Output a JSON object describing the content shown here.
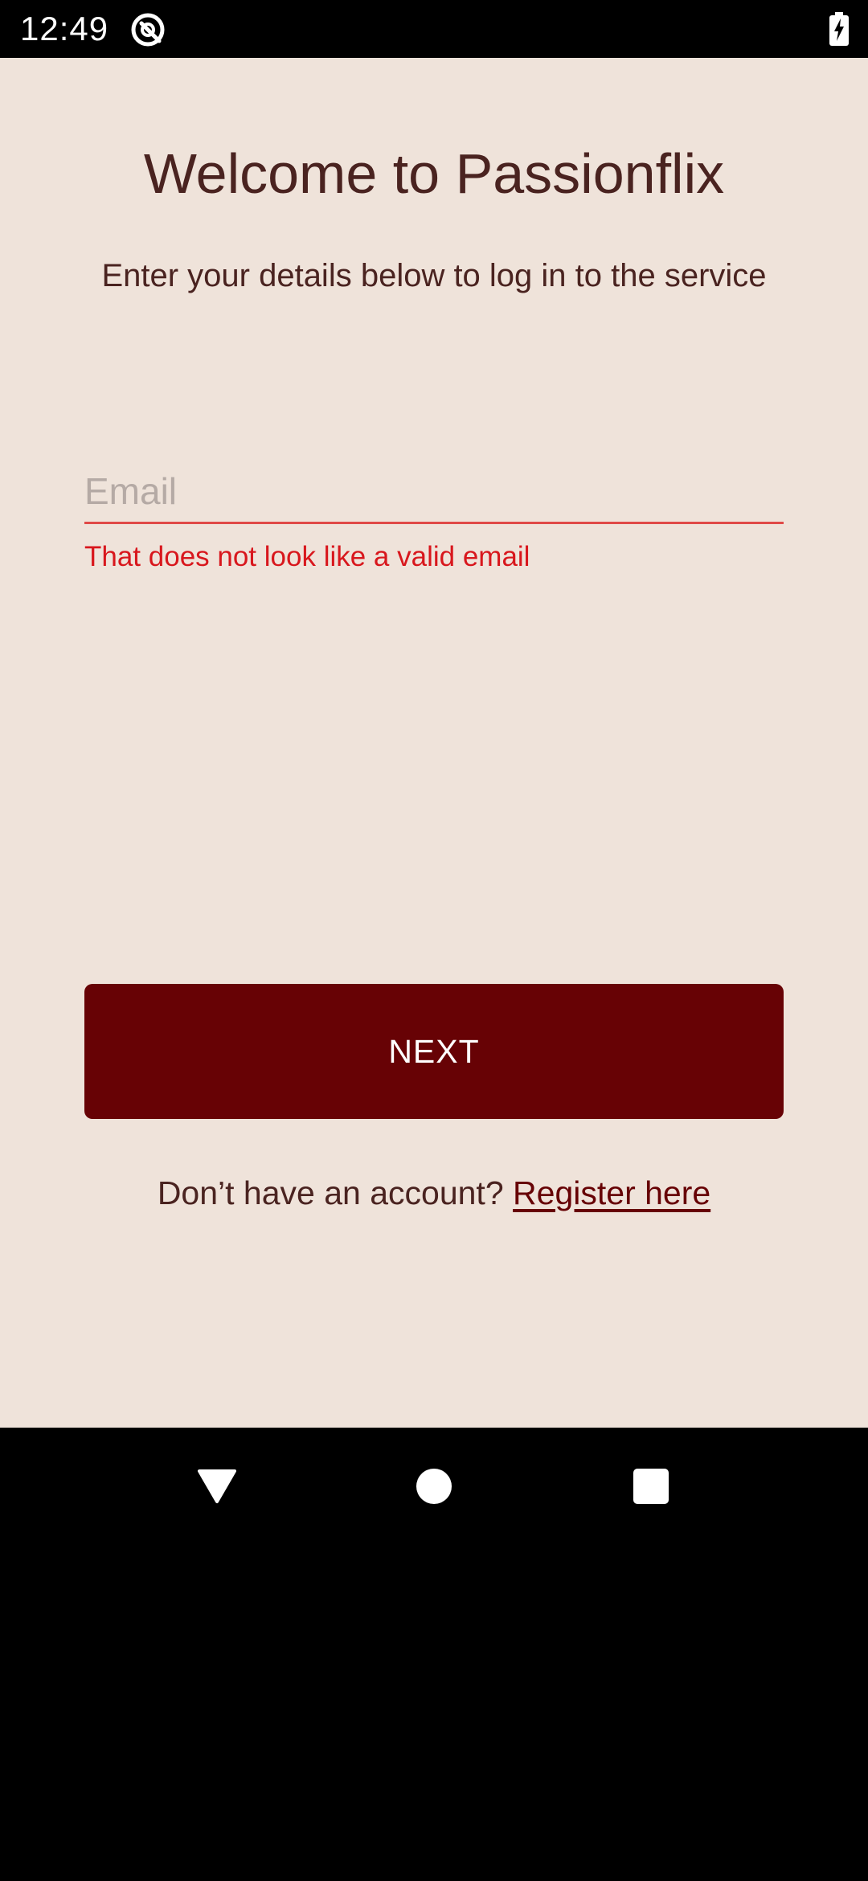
{
  "status_bar": {
    "time": "12:49",
    "icons": [
      "app-notification-icon",
      "battery-charging-icon"
    ]
  },
  "login": {
    "title": "Welcome to Passionflix",
    "subtitle": "Enter your details below to log in to the service",
    "email_placeholder": "Email",
    "email_value": "",
    "email_error": "That does not look like a valid email",
    "next_label": "NEXT",
    "register_prompt": "Don’t have an account?",
    "register_link": "Register here"
  },
  "nav_bar": {
    "icons": [
      "back-icon",
      "home-icon",
      "recents-icon"
    ]
  },
  "colors": {
    "background": "#efe3da",
    "primary": "#670205",
    "text": "#4a2320",
    "error": "#d8171d",
    "error_underline": "#e04a47",
    "placeholder": "#b5aaa5"
  }
}
